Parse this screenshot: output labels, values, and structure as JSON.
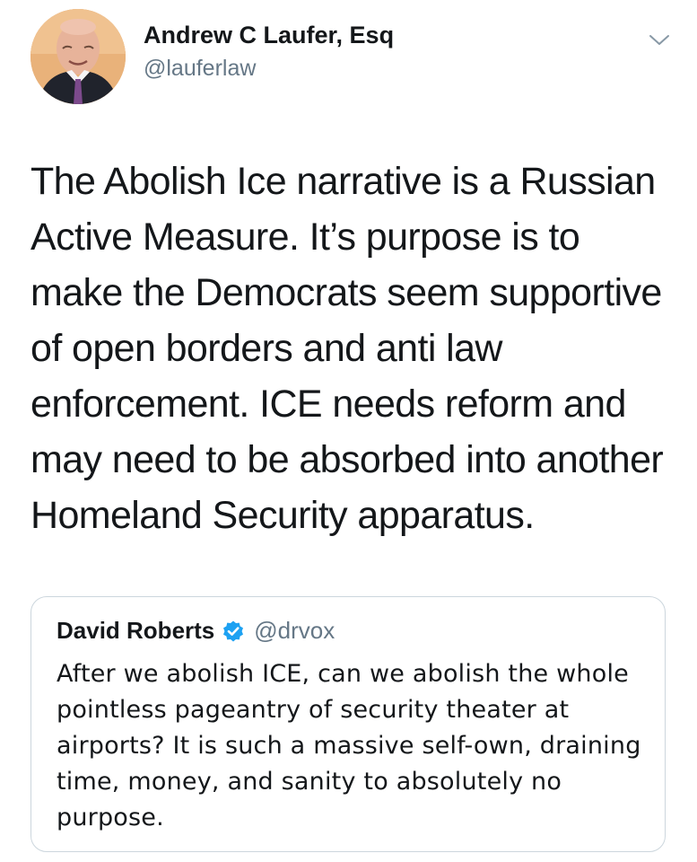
{
  "tweet": {
    "author": {
      "display_name": "Andrew C Laufer, Esq",
      "handle": "@lauferlaw",
      "avatar_icon": "profile-photo"
    },
    "menu_icon": "chevron-down-icon",
    "text": "The Abolish Ice narrative is a Russian\nActive Measure.  It’s purpose is to\nmake the Democrats seem supportive\nof open borders and anti law\nenforcement.  ICE needs reform and\nmay need to be absorbed into another\nHomeland Security apparatus."
  },
  "quoted_tweet": {
    "display_name": "David Roberts",
    "verified_icon": "verified-badge-icon",
    "handle": "@drvox",
    "text": "After we abolish ICE, can we abolish the whole pointless pageantry of security theater at airports? It is such a massive self-own, draining time, money, and sanity to absolutely no purpose."
  },
  "colors": {
    "text_primary": "#14171a",
    "text_secondary": "#657786",
    "border": "#ccd6dd",
    "verified_blue": "#1da1f2"
  }
}
